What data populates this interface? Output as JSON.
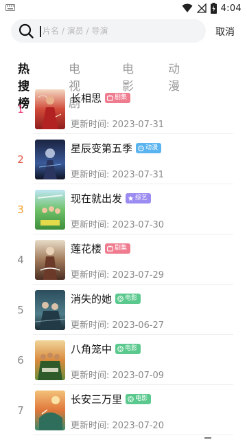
{
  "status_bar": {
    "time": "4:04",
    "icons": [
      "keyboard-icon",
      "wifi-icon",
      "no-signal-icon",
      "battery-icon"
    ]
  },
  "search": {
    "placeholder": "片名 / 演员 / 导演",
    "value": "",
    "cancel_label": "取消"
  },
  "tabs": [
    {
      "label": "热搜榜",
      "active": true
    },
    {
      "label": "电视剧",
      "active": false
    },
    {
      "label": "电影",
      "active": false
    },
    {
      "label": "动漫",
      "active": false
    }
  ],
  "date_prefix": "更新时间:",
  "items": [
    {
      "rank": "1",
      "title": "长相思",
      "badge": "剧集",
      "date": "2023-07-31"
    },
    {
      "rank": "2",
      "title": "星辰变第五季",
      "badge": "动漫",
      "date": "2023-07-31"
    },
    {
      "rank": "3",
      "title": "现在就出发",
      "badge": "综艺",
      "date": "2023-07-30"
    },
    {
      "rank": "4",
      "title": "莲花楼",
      "badge": "剧集",
      "date": "2023-07-29"
    },
    {
      "rank": "5",
      "title": "消失的她",
      "badge": "电影",
      "date": "2023-06-27"
    },
    {
      "rank": "6",
      "title": "八角笼中",
      "badge": "电影",
      "date": "2023-07-09"
    },
    {
      "rank": "7",
      "title": "长安三万里",
      "badge": "电影",
      "date": "2023-07-20"
    }
  ],
  "colors": {
    "rank_1": "#e8336b",
    "rank_2": "#e05a4a",
    "rank_3": "#f0a030",
    "rank_other": "#888888",
    "badge_drama": "#ef7b8f",
    "badge_anime": "#5ab4f0",
    "badge_variety": "#9a8cf0",
    "badge_movie": "#5bc98e"
  }
}
